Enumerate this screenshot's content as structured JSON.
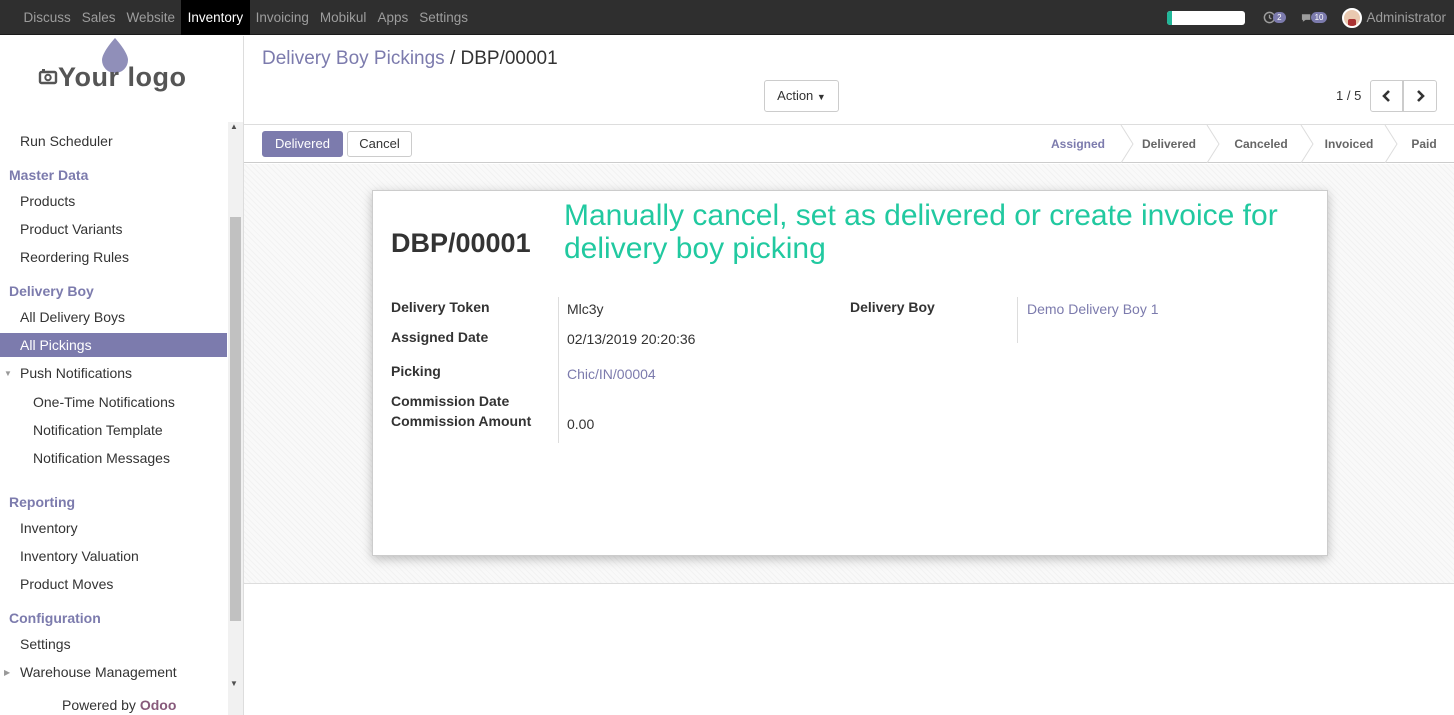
{
  "topbar": {
    "menus": [
      "Discuss",
      "Sales",
      "Website",
      "Inventory",
      "Invoicing",
      "Mobikul",
      "Apps",
      "Settings"
    ],
    "active_menu": "Inventory",
    "progress_fraction": 0.06,
    "activity_count": "2",
    "message_count": "10",
    "user_name": "Administrator"
  },
  "sidebar": {
    "logo_text": "Your logo",
    "dot_item": ".",
    "items": {
      "run_scheduler": "Run Scheduler",
      "master_data": "Master Data",
      "products": "Products",
      "product_variants": "Product Variants",
      "reordering_rules": "Reordering Rules",
      "delivery_boy": "Delivery Boy",
      "all_delivery_boys": "All Delivery Boys",
      "all_pickings": "All Pickings",
      "push_notifications": "Push Notifications",
      "one_time_notifications": "One-Time Notifications",
      "notification_template": "Notification Template",
      "notification_messages": "Notification Messages",
      "reporting": "Reporting",
      "inventory": "Inventory",
      "inventory_valuation": "Inventory Valuation",
      "product_moves": "Product Moves",
      "configuration": "Configuration",
      "settings": "Settings",
      "warehouse_management": "Warehouse Management"
    },
    "powered_by": "Powered by",
    "powered_brand": "Odoo"
  },
  "control_panel": {
    "breadcrumb_parent": "Delivery Boy Pickings",
    "breadcrumb_sep": "/",
    "breadcrumb_current": "DBP/00001",
    "action_label": "Action",
    "pager": "1 / 5"
  },
  "statusbar": {
    "delivered_button": "Delivered",
    "cancel_button": "Cancel",
    "stages": [
      "Assigned",
      "Delivered",
      "Canceled",
      "Invoiced",
      "Paid"
    ],
    "current_stage": "Assigned"
  },
  "form": {
    "record_name": "DBP/00001",
    "annotation": "Manually cancel, set as delivered or create invoice for delivery boy picking",
    "fields": {
      "delivery_token_label": "Delivery Token",
      "delivery_token": "Mlc3y",
      "assigned_date_label": "Assigned Date",
      "assigned_date": "02/13/2019 20:20:36",
      "picking_label": "Picking",
      "picking": "Chic/IN/00004",
      "commission_date_label": "Commission Date",
      "commission_date": "",
      "commission_amount_label": "Commission Amount",
      "commission_amount": "0.00",
      "delivery_boy_label": "Delivery Boy",
      "delivery_boy": "Demo Delivery Boy 1"
    }
  },
  "colors": {
    "accent": "#7c7bad",
    "annotation": "#21c9a0",
    "topbar": "#2f2f2f",
    "brand": "#875a7b"
  }
}
